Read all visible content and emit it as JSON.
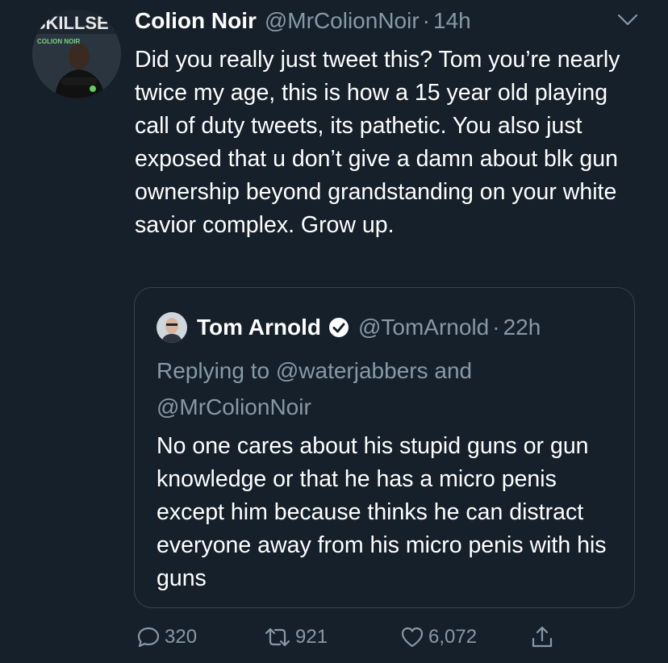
{
  "tweet": {
    "display_name": "Colion Noir",
    "handle": "@MrColionNoir",
    "separator": "·",
    "time": "14h",
    "text": "Did you really just tweet this? Tom you’re nearly twice my age, this is how a 15 year old playing call of duty tweets, its pathetic. You also just exposed that u don’t give a damn about blk gun ownership beyond grandstanding on your white savior complex. Grow up.",
    "avatar_text": {
      "masthead": "SKILLSET",
      "sub": "COLION NOIR"
    }
  },
  "quoted": {
    "display_name": "Tom Arnold",
    "handle": "@TomArnold",
    "separator": "·",
    "time": "22h",
    "replying": "Replying to @waterjabbers and @MrColionNoir",
    "text": "No one cares about his stupid guns or gun knowledge or that he has a micro penis except him because thinks he can distract everyone away from his micro penis with his guns"
  },
  "actions": {
    "replies": "320",
    "retweets": "921",
    "likes": "6,072"
  },
  "colors": {
    "background": "#15202b",
    "secondary_text": "#8899a6",
    "border": "#38444d",
    "verified": "#ffffff"
  }
}
